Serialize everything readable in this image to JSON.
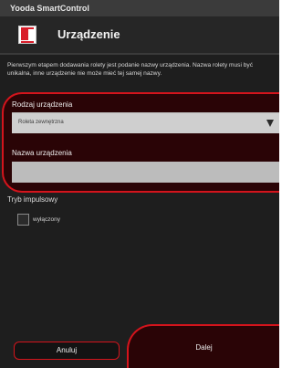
{
  "app": {
    "title": "Yooda SmartControl"
  },
  "header": {
    "title": "Urządzenie",
    "icon": "roller-blind-device-icon"
  },
  "description": "Pierwszym etapem dodawania rolety jest podanie nazwy urządzenia. Nazwa rolety musi być unikalna, inne urządzenie nie może mieć tej samej nazwy.",
  "form": {
    "device_type_label": "Rodzaj urządzenia",
    "device_type_value": "Roleta zewnętrzna",
    "device_name_label": "Nazwa urządzenia",
    "device_name_value": "",
    "impulse_mode_label": "Tryb impulsowy",
    "impulse_checkbox_label": "wyłączony",
    "impulse_checked": false
  },
  "buttons": {
    "cancel": "Anuluj",
    "next": "Dalej"
  },
  "colors": {
    "accent": "#d4141c",
    "panel": "#2a0406",
    "background": "#1e1e1e"
  }
}
